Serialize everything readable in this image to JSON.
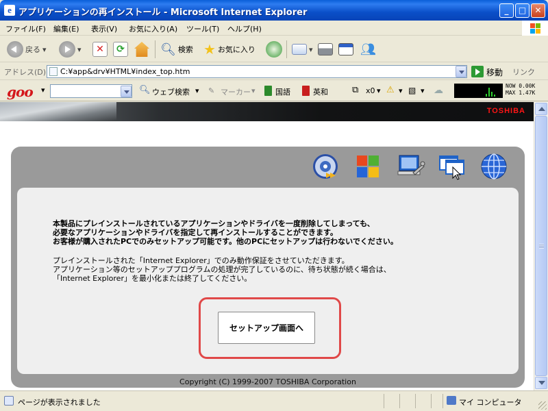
{
  "window": {
    "title": "アプリケーションの再インストール - Microsoft Internet Explorer"
  },
  "menu": {
    "items": [
      "ファイル(F)",
      "編集(E)",
      "表示(V)",
      "お気に入り(A)",
      "ツール(T)",
      "ヘルプ(H)"
    ]
  },
  "toolbar": {
    "back_label": "戻る",
    "search_label": "検索",
    "favorites_label": "お気に入り"
  },
  "address": {
    "label": "アドレス(D)",
    "url": "C:¥app&drv¥HTML¥index_top.htm",
    "go_label": "移動",
    "links_label": "リンク"
  },
  "goo": {
    "logo": "goo",
    "web_search": "ウェブ検索",
    "marker": "マーカー",
    "japanese": "国語",
    "english": "英和",
    "x0": "x0",
    "meter_now": "NOW  0.00K",
    "meter_max": "MAX  1.47K"
  },
  "page": {
    "brand": "TOSHIBA",
    "warning_line1": "本製品にプレインストールされているアプリケーションやドライバを一度削除してしまっても、",
    "warning_line2": "必要なアプリケーションやドライバを指定して再インストールすることができます。",
    "warning_line3": "お客様が購入されたPCでのみセットアップ可能です。他のPCにセットアップは行わないでください。",
    "note_line1": "プレインストールされた「Internet Explorer」でのみ動作保証をさせていただきます。",
    "note_line2": "アプリケーション等のセットアッププログラムの処理が完了しているのに、待ち状態が続く場合は、",
    "note_line3": "「Internet Explorer」を最小化または終了してください。",
    "setup_button": "セットアップ画面へ",
    "copyright": "Copyright (C) 1999-2007 TOSHIBA Corporation"
  },
  "status": {
    "text": "ページが表示されました",
    "zone": "マイ コンピュータ"
  },
  "icons": {
    "nav": [
      "disc-icon",
      "windows-icon",
      "computer-tools-icon",
      "window-cursor-icon",
      "globe-icon"
    ]
  },
  "colors": {
    "title_bar": "#0a4fc8",
    "brand_red": "#ff1515",
    "highlight_red": "#e04848",
    "panel_gray": "#9a9a9a"
  }
}
